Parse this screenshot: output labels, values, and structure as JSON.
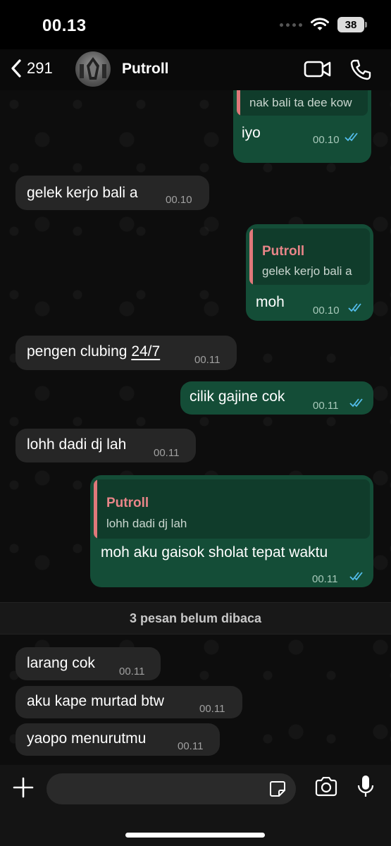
{
  "status": {
    "time": "00.13",
    "battery": "38"
  },
  "header": {
    "back_count": "291",
    "contact_name": "Putroll"
  },
  "messages": [
    {
      "dir": "out",
      "quote_name": "Putroll",
      "quote_text": "nak bali ta dee kow",
      "text": "iyo",
      "time": "00.10",
      "read": true
    },
    {
      "dir": "in",
      "text": "gelek kerjo bali a",
      "time": "00.10"
    },
    {
      "dir": "out",
      "quote_name": "Putroll",
      "quote_text": "gelek kerjo bali a",
      "text": "moh",
      "time": "00.10",
      "read": true
    },
    {
      "dir": "in",
      "text": "pengen clubing",
      "text_link": "24/7",
      "time": "00.11"
    },
    {
      "dir": "out",
      "text": "cilik gajine cok",
      "time": "00.11",
      "read": true
    },
    {
      "dir": "in",
      "text": "lohh dadi dj lah",
      "time": "00.11"
    },
    {
      "dir": "out",
      "quote_name": "Putroll",
      "quote_text": "lohh dadi dj lah",
      "text": "moh aku gaisok sholat tepat waktu",
      "time": "00.11",
      "read": true
    },
    {
      "dir": "in",
      "text": "larang cok",
      "time": "00.11"
    },
    {
      "dir": "in",
      "text": "aku kape murtad btw",
      "time": "00.11"
    },
    {
      "dir": "in",
      "text": "yaopo menurutmu",
      "time": "00.11"
    }
  ],
  "unread_banner": "3 pesan belum dibaca",
  "input": {
    "placeholder": ""
  },
  "colors": {
    "incoming": "#262626",
    "outgoing": "#144d37",
    "quote_name": "#e88588",
    "read_tick": "#53bdeb"
  },
  "icons": [
    "back-chevron-icon",
    "video-call-icon",
    "phone-icon",
    "plus-icon",
    "sticker-icon",
    "camera-icon",
    "microphone-icon",
    "read-receipt-icon",
    "wifi-icon",
    "signal-icon",
    "battery-icon"
  ]
}
